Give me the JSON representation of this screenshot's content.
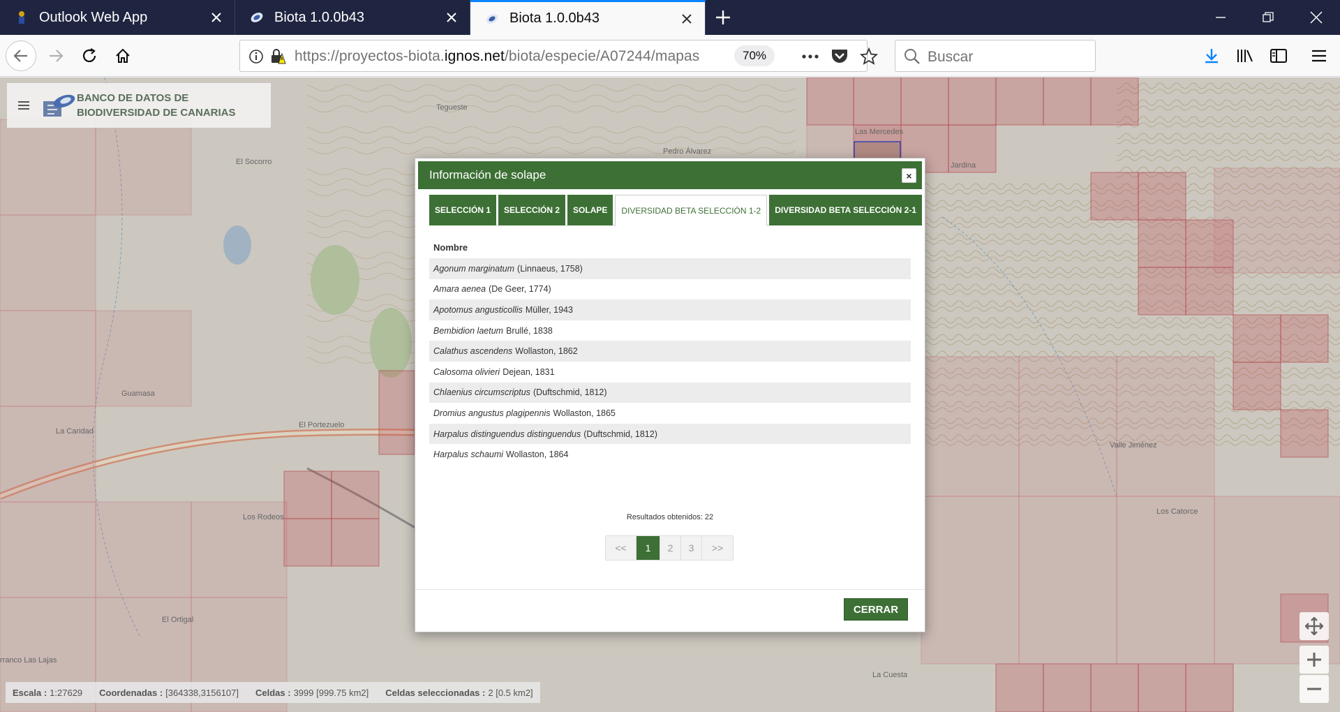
{
  "browser": {
    "tabs": [
      {
        "title": "Outlook Web App",
        "active": false
      },
      {
        "title": "Biota 1.0.0b43",
        "active": false
      },
      {
        "title": "Biota 1.0.0b43",
        "active": true
      }
    ],
    "url_prefix": "https://proyectos-biota.",
    "url_domain": "ignos.net",
    "url_path": "/biota/especie/A07244/mapas",
    "zoom": "70%",
    "search_placeholder": "Buscar",
    "accent_color": "#0a84ff"
  },
  "app": {
    "logo_line1": "BANCO DE DATOS DE",
    "logo_line2": "BIODIVERSIDAD DE CANARIAS",
    "brand_color": "#3d7035"
  },
  "map_labels": [
    {
      "id": "tegueste",
      "text": "Tegueste"
    },
    {
      "id": "el-socorro",
      "text": "El Socorro"
    },
    {
      "id": "pedro-alvarez",
      "text": "Pedro Álvarez"
    },
    {
      "id": "las-mercedes",
      "text": "Las Mercedes"
    },
    {
      "id": "jardina",
      "text": "Jardina"
    },
    {
      "id": "guamasa",
      "text": "Guamasa"
    },
    {
      "id": "la-caridad",
      "text": "La Caridad"
    },
    {
      "id": "el-portezuelo",
      "text": "El Portezuelo"
    },
    {
      "id": "los-rodeos",
      "text": "Los Rodeos"
    },
    {
      "id": "el-ortigal",
      "text": "El Ortigal"
    },
    {
      "id": "barranco-las-lajas",
      "text": "rranco Las Lajas"
    },
    {
      "id": "valle-jimenez",
      "text": "Valle Jiménez"
    },
    {
      "id": "los-catorce",
      "text": "Los Catorce"
    },
    {
      "id": "la-cuesta",
      "text": "La Cuesta"
    }
  ],
  "status": {
    "escala_label": "Escala :",
    "escala_value": "1:27629",
    "coord_label": "Coordenadas :",
    "coord_value": "[364338,3156107]",
    "celdas_label": "Celdas :",
    "celdas_value": "3999 [999.75 km2]",
    "sel_label": "Celdas seleccionadas :",
    "sel_value": "2 [0.5 km2]"
  },
  "modal": {
    "title": "Información de solape",
    "tabs": [
      {
        "label": "SELECCIÓN 1",
        "active": false
      },
      {
        "label": "SELECCIÓN 2",
        "active": false
      },
      {
        "label": "SOLAPE",
        "active": false
      },
      {
        "label": "DIVERSIDAD BETA SELECCIÓN 1-2",
        "active": true
      },
      {
        "label": "DIVERSIDAD BETA SELECCIÓN 2-1",
        "active": false
      }
    ],
    "column_header": "Nombre",
    "rows": [
      {
        "species": "Agonum marginatum",
        "author": "(Linnaeus, 1758)"
      },
      {
        "species": "Amara aenea",
        "author": "(De Geer, 1774)"
      },
      {
        "species": "Apotomus angusticollis",
        "author": "Müller, 1943"
      },
      {
        "species": "Bembidion laetum",
        "author": "Brullé, 1838"
      },
      {
        "species": "Calathus ascendens",
        "author": "Wollaston, 1862"
      },
      {
        "species": "Calosoma olivieri",
        "author": "Dejean, 1831"
      },
      {
        "species": "Chlaenius circumscriptus",
        "author": "(Duftschmid, 1812)"
      },
      {
        "species": "Dromius angustus plagipennis",
        "author": "Wollaston, 1865"
      },
      {
        "species": "Harpalus distinguendus distinguendus",
        "author": "(Duftschmid, 1812)"
      },
      {
        "species": "Harpalus schaumi",
        "author": "Wollaston, 1864"
      }
    ],
    "results_text": "Resultados obtenidos: 22",
    "pager": {
      "first": "<<",
      "pages": [
        "1",
        "2",
        "3"
      ],
      "current": "1",
      "last": ">>"
    },
    "close_button": "CERRAR",
    "close_x": "×"
  }
}
